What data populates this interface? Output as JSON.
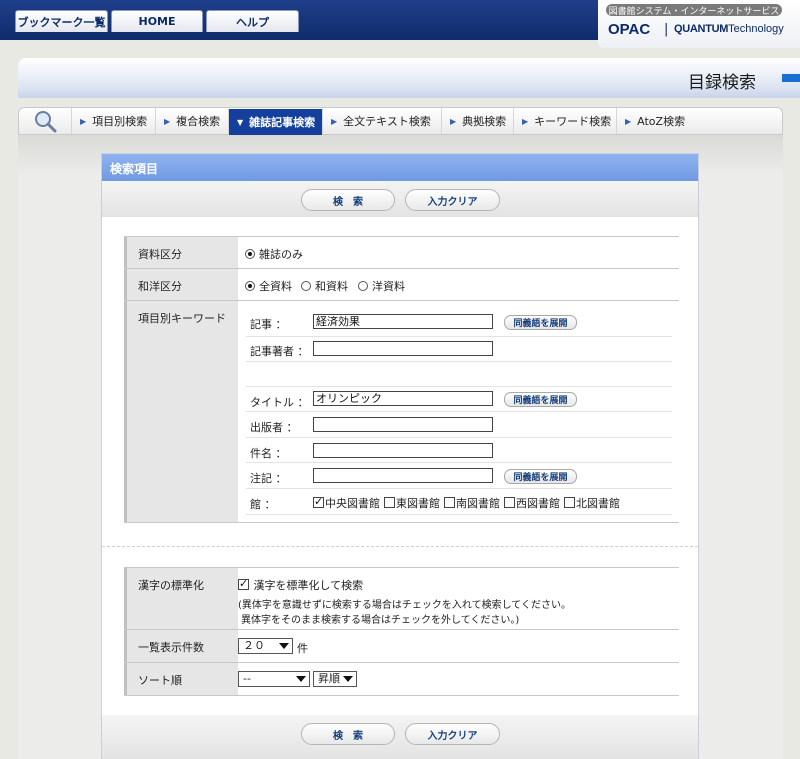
{
  "top_nav": {
    "tabs": [
      {
        "label": "ブックマーク一覧"
      },
      {
        "label": "HOME"
      },
      {
        "label": "ヘルプ"
      }
    ]
  },
  "brand": {
    "subtitle": "図書館システム・インターネットサービス",
    "opac": "OPAC",
    "separator": "|",
    "company_bold": "QUANTUM",
    "company_rest": "Technology"
  },
  "header": {
    "title": "目録検索"
  },
  "search_tabs": [
    {
      "label": "項目別検索",
      "active": false
    },
    {
      "label": "複合検索",
      "active": false
    },
    {
      "label": "雑誌記事検索",
      "active": true
    },
    {
      "label": "全文テキスト検索",
      "active": false
    },
    {
      "label": "典拠検索",
      "active": false
    },
    {
      "label": "キーワード検索",
      "active": false
    },
    {
      "label": "AtoZ検索",
      "active": false
    }
  ],
  "panel": {
    "title": "検索項目",
    "search_button": "検　索",
    "clear_button": "入力クリア",
    "material_type": {
      "label": "資料区分",
      "option": "雑誌のみ"
    },
    "language_type": {
      "label": "和洋区分",
      "options": [
        "全資料",
        "和資料",
        "洋資料"
      ],
      "selected": "全資料"
    },
    "keywords": {
      "label": "項目別キーワード",
      "synonym_button": "同義語を展開",
      "fields": [
        {
          "label": "記事 ：",
          "value": "経済効果"
        },
        {
          "label": "記事著者 ：",
          "value": ""
        },
        {
          "label": "タイトル ：",
          "value": "オリンピック"
        },
        {
          "label": "出版者 ：",
          "value": ""
        },
        {
          "label": "件名 ：",
          "value": ""
        },
        {
          "label": "注記 ：",
          "value": ""
        }
      ],
      "library": {
        "label": "館 ：",
        "options": [
          {
            "label": "中央図書館",
            "checked": true
          },
          {
            "label": "東図書館",
            "checked": false
          },
          {
            "label": "南図書館",
            "checked": false
          },
          {
            "label": "西図書館",
            "checked": false
          },
          {
            "label": "北図書館",
            "checked": false
          }
        ]
      }
    },
    "kanji": {
      "label": "漢字の標準化",
      "checkbox_label": "漢字を標準化して検索",
      "checked": true,
      "note1": "(異体字を意識せずに検索する場合はチェックを入れて検索してください。",
      "note2": "異体字をそのまま検索する場合はチェックを外してください。)"
    },
    "page_size": {
      "label": "一覧表示件数",
      "value": "２０",
      "unit": "件"
    },
    "sort": {
      "label": "ソート順",
      "field_value": "--",
      "order_value": "昇順"
    }
  }
}
